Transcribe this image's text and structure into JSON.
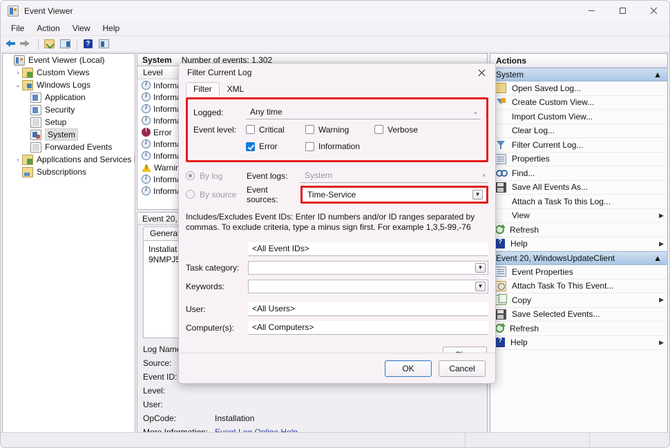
{
  "window": {
    "title": "Event Viewer",
    "icon": "event-viewer-icon",
    "controls": {
      "minimize": "–",
      "maximize": "□",
      "close": "✕"
    }
  },
  "menubar": {
    "items": [
      "File",
      "Action",
      "View",
      "Help"
    ]
  },
  "toolbar": {
    "items": [
      {
        "name": "back-icon"
      },
      {
        "name": "forward-icon"
      },
      {
        "name": "show-hide-folder-icon"
      },
      {
        "name": "show-hide-console-tree-icon"
      },
      {
        "name": "help-icon"
      },
      {
        "name": "show-hide-action-pane-icon"
      }
    ]
  },
  "tree": {
    "items": [
      {
        "label": "Event Viewer (Local)",
        "indent": 0,
        "chevron": "",
        "icon": "event-viewer-icon",
        "selected": false
      },
      {
        "label": "Custom Views",
        "indent": 1,
        "chevron": "›",
        "icon": "custom-views-folder-icon",
        "selected": false
      },
      {
        "label": "Windows Logs",
        "indent": 1,
        "chevron": "⌄",
        "icon": "windows-logs-folder-icon",
        "selected": false
      },
      {
        "label": "Application",
        "indent": 2,
        "chevron": "",
        "icon": "application-log-icon",
        "selected": false
      },
      {
        "label": "Security",
        "indent": 2,
        "chevron": "",
        "icon": "security-log-icon",
        "selected": false
      },
      {
        "label": "Setup",
        "indent": 2,
        "chevron": "",
        "icon": "setup-log-icon",
        "selected": false
      },
      {
        "label": "System",
        "indent": 2,
        "chevron": "",
        "icon": "system-log-icon",
        "selected": true
      },
      {
        "label": "Forwarded Events",
        "indent": 2,
        "chevron": "",
        "icon": "forwarded-events-icon",
        "selected": false
      },
      {
        "label": "Applications and Services Logs",
        "indent": 1,
        "chevron": "›",
        "icon": "app-services-folder-icon",
        "selected": false
      },
      {
        "label": "Subscriptions",
        "indent": 1,
        "chevron": "",
        "icon": "subscriptions-icon",
        "selected": false
      }
    ]
  },
  "center": {
    "log_name": "System",
    "event_count_label": "Number of events: 1,302",
    "column_header": "Level",
    "rows": [
      {
        "level": "Information",
        "severity": "info"
      },
      {
        "level": "Information",
        "severity": "info"
      },
      {
        "level": "Information",
        "severity": "info"
      },
      {
        "level": "Information",
        "severity": "info"
      },
      {
        "level": "Error",
        "severity": "error"
      },
      {
        "level": "Information",
        "severity": "info"
      },
      {
        "level": "Information",
        "severity": "info"
      },
      {
        "level": "Warning",
        "severity": "warning"
      },
      {
        "level": "Information",
        "severity": "info"
      },
      {
        "level": "Information",
        "severity": "info"
      }
    ]
  },
  "detail": {
    "title": "Event 20, WindowsUpdateClient",
    "tabs": [
      "General"
    ],
    "body_lines": [
      "Installat",
      "9NMPJ5"
    ],
    "fields": [
      {
        "key": "Log Name:",
        "value": ""
      },
      {
        "key": "Source:",
        "value": ""
      },
      {
        "key": "Event ID:",
        "value": ""
      },
      {
        "key": "Level:",
        "value": ""
      },
      {
        "key": "User:",
        "value": ""
      },
      {
        "key": "OpCode:",
        "value": "Installation"
      },
      {
        "key": "More Information:",
        "value": "Event Log Online Help",
        "link": true
      }
    ]
  },
  "actions": {
    "header": "Actions",
    "groups": [
      {
        "title": "System",
        "collapse_icon": "chevron-up-icon",
        "items": [
          {
            "label": "Open Saved Log...",
            "icon": "open-saved-log-icon",
            "submenu": false
          },
          {
            "label": "Create Custom View...",
            "icon": "create-custom-view-icon",
            "submenu": false
          },
          {
            "label": "Import Custom View...",
            "icon": "",
            "submenu": false
          },
          {
            "label": "Clear Log...",
            "icon": "",
            "submenu": false
          },
          {
            "label": "Filter Current Log...",
            "icon": "filter-icon",
            "submenu": false
          },
          {
            "label": "Properties",
            "icon": "properties-icon",
            "submenu": false
          },
          {
            "label": "Find...",
            "icon": "find-icon",
            "submenu": false
          },
          {
            "label": "Save All Events As...",
            "icon": "save-icon",
            "submenu": false
          },
          {
            "label": "Attach a Task To this Log...",
            "icon": "",
            "submenu": false
          },
          {
            "label": "View",
            "icon": "",
            "submenu": true
          },
          {
            "label": "Refresh",
            "icon": "refresh-icon",
            "submenu": false
          },
          {
            "label": "Help",
            "icon": "help-icon",
            "submenu": true
          }
        ]
      },
      {
        "title": "Event 20, WindowsUpdateClient",
        "collapse_icon": "chevron-up-icon",
        "items": [
          {
            "label": "Event Properties",
            "icon": "properties-icon",
            "submenu": false
          },
          {
            "label": "Attach Task To This Event...",
            "icon": "attach-task-icon",
            "submenu": false
          },
          {
            "label": "Copy",
            "icon": "copy-icon",
            "submenu": true
          },
          {
            "label": "Save Selected Events...",
            "icon": "save-icon",
            "submenu": false
          },
          {
            "label": "Refresh",
            "icon": "refresh-icon",
            "submenu": false
          },
          {
            "label": "Help",
            "icon": "help-icon",
            "submenu": true
          }
        ]
      }
    ]
  },
  "dialog": {
    "title": "Filter Current Log",
    "close_icon": "close-icon",
    "tabs": [
      {
        "label": "Filter",
        "active": true
      },
      {
        "label": "XML",
        "active": false
      }
    ],
    "logged": {
      "label": "Logged:",
      "value": "Any time",
      "chevron": "chevron-down-icon"
    },
    "event_level": {
      "label": "Event level:",
      "options": [
        {
          "label": "Critical",
          "checked": false
        },
        {
          "label": "Warning",
          "checked": false
        },
        {
          "label": "Verbose",
          "checked": false
        },
        {
          "label": "Error",
          "checked": true
        },
        {
          "label": "Information",
          "checked": false
        }
      ]
    },
    "by_log": {
      "label": "By log",
      "selected": true,
      "disabled": true
    },
    "by_source": {
      "label": "By source",
      "selected": false,
      "disabled": true
    },
    "event_logs": {
      "label": "Event logs:",
      "value": "System",
      "disabled": true
    },
    "event_sources": {
      "label": "Event sources:",
      "value": "Time-Service",
      "highlighted": true
    },
    "help_text": "Includes/Excludes Event IDs: Enter ID numbers and/or ID ranges separated by commas. To exclude criteria, type a minus sign first. For example 1,3,5-99,-76",
    "event_ids": {
      "value": "<All Event IDs>"
    },
    "task_category": {
      "label": "Task category:",
      "value": ""
    },
    "keywords": {
      "label": "Keywords:",
      "value": ""
    },
    "user": {
      "label": "User:",
      "value": "<All Users>"
    },
    "computers": {
      "label": "Computer(s):",
      "value": "<All Computers>"
    },
    "clear_button": "Clear",
    "ok_button": "OK",
    "cancel_button": "Cancel"
  },
  "colors": {
    "highlight_red": "#e21b1b",
    "accent_blue": "#0f7ddb",
    "group_header_blue": "#a9c6e4",
    "link": "#2b3fa0"
  }
}
